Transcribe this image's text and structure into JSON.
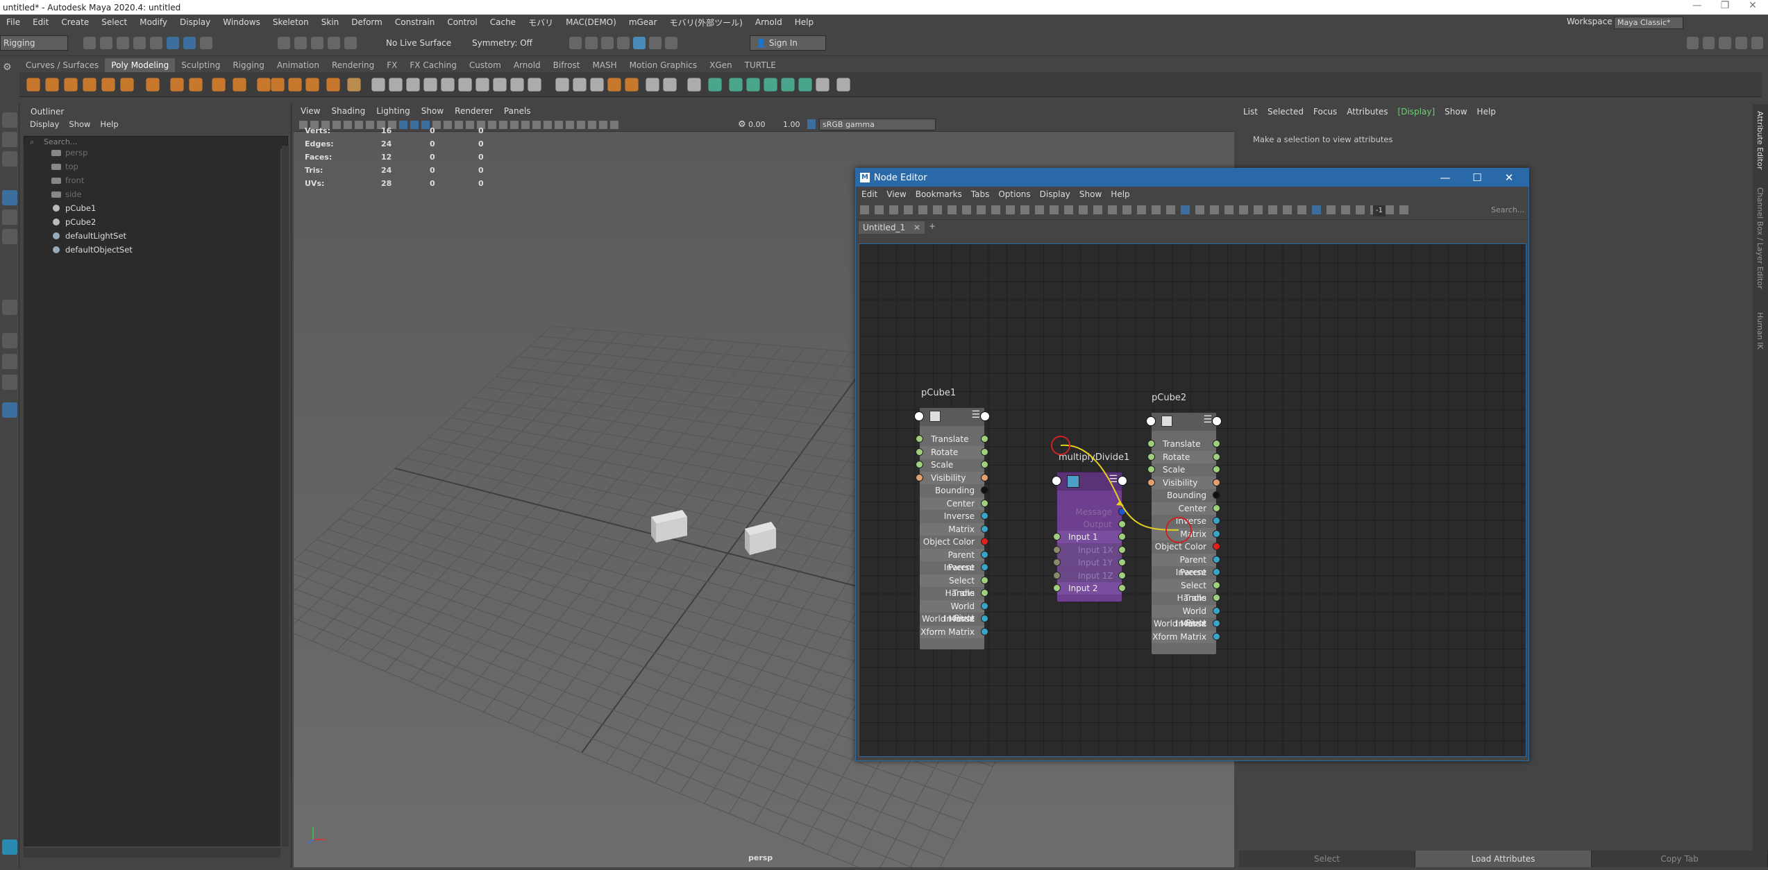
{
  "window": {
    "title": "untitled* - Autodesk Maya 2020.4: untitled"
  },
  "menubar": [
    "File",
    "Edit",
    "Create",
    "Select",
    "Modify",
    "Display",
    "Windows",
    "Skeleton",
    "Skin",
    "Deform",
    "Constrain",
    "Control",
    "Cache",
    "モバリ",
    "MAC(DEMO)",
    "mGear",
    "モバリ(外部ツール)",
    "Arnold",
    "Help"
  ],
  "workspace": {
    "label": "Workspace :",
    "value": "Maya Classic*"
  },
  "statusline": {
    "menuset": "Rigging",
    "live_surface": "No Live Surface",
    "symmetry": "Symmetry: Off",
    "sign_in": "Sign In"
  },
  "shelf_tabs": [
    "Curves / Surfaces",
    "Poly Modeling",
    "Sculpting",
    "Rigging",
    "Animation",
    "Rendering",
    "FX",
    "FX Caching",
    "Custom",
    "Arnold",
    "Bifrost",
    "MASH",
    "Motion Graphics",
    "XGen",
    "TURTLE"
  ],
  "shelf_active": "Poly Modeling",
  "outliner": {
    "title": "Outliner",
    "menu": [
      "Display",
      "Show",
      "Help"
    ],
    "search_placeholder": "Search...",
    "items": [
      {
        "label": "persp",
        "dim": true,
        "icon": "camera-icon"
      },
      {
        "label": "top",
        "dim": true,
        "icon": "camera-icon"
      },
      {
        "label": "front",
        "dim": true,
        "icon": "camera-icon"
      },
      {
        "label": "side",
        "dim": true,
        "icon": "camera-icon"
      },
      {
        "label": "pCube1",
        "dim": false,
        "icon": "mesh-icon"
      },
      {
        "label": "pCube2",
        "dim": false,
        "icon": "mesh-icon"
      },
      {
        "label": "defaultLightSet",
        "dim": false,
        "icon": "set-icon"
      },
      {
        "label": "defaultObjectSet",
        "dim": false,
        "icon": "set-icon"
      }
    ]
  },
  "viewport": {
    "menu": [
      "View",
      "Shading",
      "Lighting",
      "Show",
      "Renderer",
      "Panels"
    ],
    "near": "0.00",
    "far": "1.00",
    "colorspace": "sRGB gamma",
    "camera": "persp",
    "hud": [
      {
        "label": "Verts:",
        "v1": "16",
        "v2": "0",
        "v3": "0"
      },
      {
        "label": "Edges:",
        "v1": "24",
        "v2": "0",
        "v3": "0"
      },
      {
        "label": "Faces:",
        "v1": "12",
        "v2": "0",
        "v3": "0"
      },
      {
        "label": "Tris:",
        "v1": "24",
        "v2": "0",
        "v3": "0"
      },
      {
        "label": "UVs:",
        "v1": "28",
        "v2": "0",
        "v3": "0"
      }
    ]
  },
  "attribute_editor": {
    "menu": [
      "List",
      "Selected",
      "Focus",
      "Attributes",
      "[Display]",
      "Show",
      "Help"
    ],
    "message": "Make a selection to view attributes",
    "buttons": [
      "Select",
      "Load Attributes",
      "Copy Tab"
    ],
    "side_tabs": [
      "Attribute Editor",
      "Channel Box / Layer Editor",
      "Human IK"
    ]
  },
  "node_editor": {
    "title": "Node Editor",
    "menu": [
      "Edit",
      "View",
      "Bookmarks",
      "Tabs",
      "Options",
      "Display",
      "Show",
      "Help"
    ],
    "tab": "Untitled_1",
    "search_placeholder": "Search...",
    "size_value": "-1",
    "nodes": {
      "pCube1": {
        "name": "pCube1",
        "inputs": [
          "Translate",
          "Rotate",
          "Scale",
          "Visibility"
        ],
        "outputs": [
          "Bounding Box",
          "Center",
          "Inverse Matrix",
          "Matrix",
          "Object Color RGB",
          "Parent Inverse Matrix",
          "Parent Matrix",
          "Select Handle",
          "Trans Minu...tate Pivot",
          "World Inverse Matrix",
          "World Matrix",
          "Xform Matrix"
        ]
      },
      "pCube2": {
        "name": "pCube2",
        "inputs": [
          "Translate",
          "Rotate",
          "Scale",
          "Visibility"
        ],
        "outputs": [
          "Bounding Box",
          "Center",
          "Inverse Matrix",
          "Matrix",
          "Object Color RGB",
          "Parent Inverse Matrix",
          "Parent Matrix",
          "Select Handle",
          "Trans Minu...tate Pivot",
          "World Inverse Matrix",
          "World Matrix",
          "Xform Matrix"
        ]
      },
      "multiplyDivide1": {
        "name": "multiplyDivide1",
        "message": "Message",
        "output": "Output",
        "inputs": [
          "Input 1",
          "Input 1X",
          "Input 1Y",
          "Input 1Z",
          "Input 2"
        ]
      }
    },
    "plug_colors": {
      "vector": "#9fcf7f",
      "scalar": "#e0a070",
      "matrix": "#3aa4c6",
      "bbox": "#111111",
      "color": "#e02020",
      "message": "#2255cc",
      "connection": "#e8d020",
      "highlight": "#cc2222"
    }
  }
}
